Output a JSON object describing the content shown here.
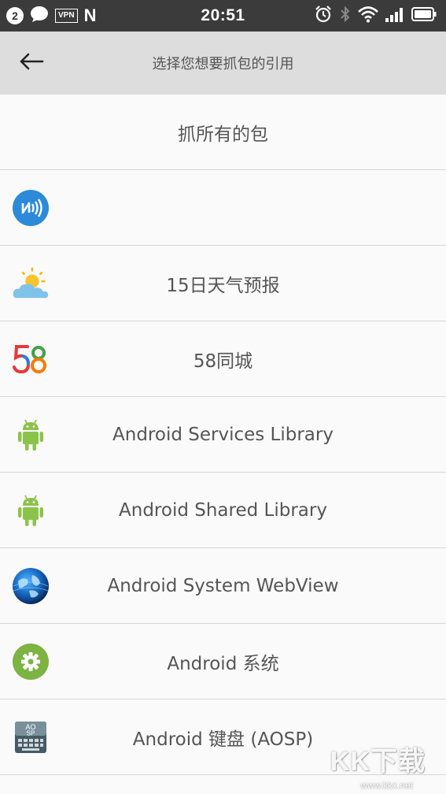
{
  "status_bar": {
    "notification_count": "2",
    "vpn_label": "VPN",
    "n_label": "N",
    "time": "20:51"
  },
  "app_bar": {
    "title": "选择您想要抓包的引用",
    "back_icon": "arrow-left-icon"
  },
  "list": {
    "items": [
      {
        "label": "抓所有的包",
        "icon": ""
      },
      {
        "label": "",
        "icon": "nfc-icon"
      },
      {
        "label": "15日天气预报",
        "icon": "weather-icon"
      },
      {
        "label": "58同城",
        "icon": "58-logo-icon"
      },
      {
        "label": "Android Services Library",
        "icon": "android-icon"
      },
      {
        "label": "Android Shared Library",
        "icon": "android-icon"
      },
      {
        "label": "Android System WebView",
        "icon": "globe-icon"
      },
      {
        "label": "Android 系统",
        "icon": "gear-icon"
      },
      {
        "label": "Android 键盘 (AOSP)",
        "icon": "keyboard-icon"
      }
    ]
  },
  "colors": {
    "status_bar_bg": "#3b3b3b",
    "app_bar_bg": "#dddddd",
    "list_bg": "#fafafa",
    "android_green": "#8bc34a"
  },
  "watermark": {
    "big": "KK下载",
    "small": "www.kkx.net"
  }
}
